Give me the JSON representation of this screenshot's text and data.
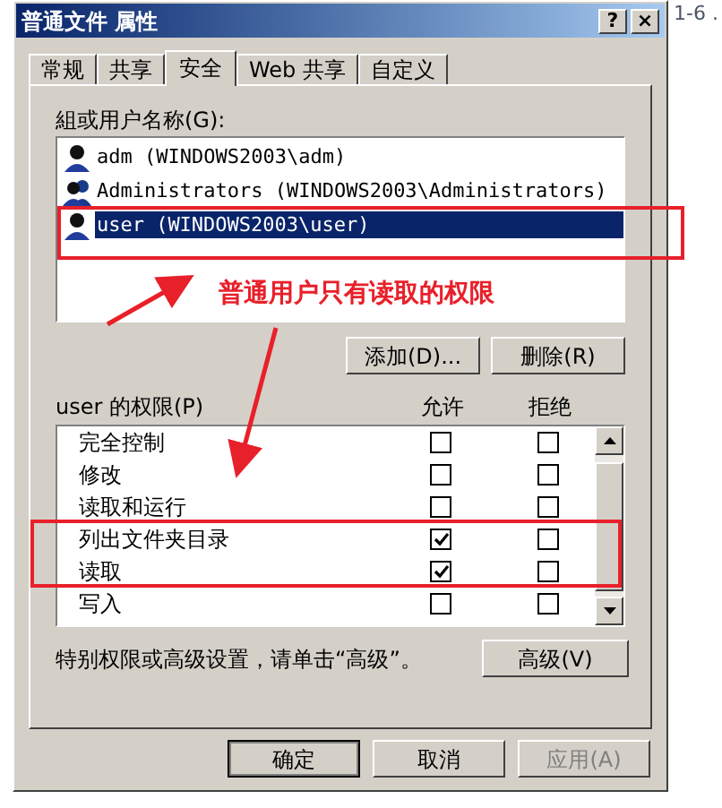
{
  "background_text": "1-6 .",
  "window": {
    "title": "普通文件 属性",
    "title_buttons": [
      "?",
      "×"
    ]
  },
  "tabs": [
    {
      "label": "常规",
      "selected": false
    },
    {
      "label": "共享",
      "selected": false
    },
    {
      "label": "安全",
      "selected": true
    },
    {
      "label": "Web 共享",
      "selected": false
    },
    {
      "label": "自定义",
      "selected": false
    }
  ],
  "users": {
    "label": "組或用户名称(G):",
    "items": [
      {
        "name": "adm (WINDOWS2003\\adm)",
        "kind": "user",
        "selected": false
      },
      {
        "name": "Administrators (WINDOWS2003\\Administrators)",
        "kind": "group",
        "selected": false
      },
      {
        "name": "user (WINDOWS2003\\user)",
        "kind": "user",
        "selected": true
      }
    ]
  },
  "user_buttons": [
    "添加(D)...",
    "删除(R)"
  ],
  "permissions": {
    "label": "user 的权限(P)",
    "columns": [
      "允许",
      "拒绝"
    ],
    "rows": [
      {
        "name": "完全控制",
        "allow": false,
        "deny": false
      },
      {
        "name": "修改",
        "allow": false,
        "deny": false
      },
      {
        "name": "读取和运行",
        "allow": false,
        "deny": false
      },
      {
        "name": "列出文件夹目录",
        "allow": true,
        "deny": false
      },
      {
        "name": "读取",
        "allow": true,
        "deny": false
      },
      {
        "name": "写入",
        "allow": false,
        "deny": false
      }
    ]
  },
  "advanced_hint": "特别权限或高级设置，请单击“高级”。",
  "advanced_button": "高级(V)",
  "buttons": [
    {
      "label": "确定",
      "disabled": false,
      "default": true
    },
    {
      "label": "取消",
      "disabled": false,
      "default": false
    },
    {
      "label": "应用(A)",
      "disabled": true,
      "default": false
    }
  ],
  "annotation": {
    "text": "普通用户只有读取的权限"
  }
}
